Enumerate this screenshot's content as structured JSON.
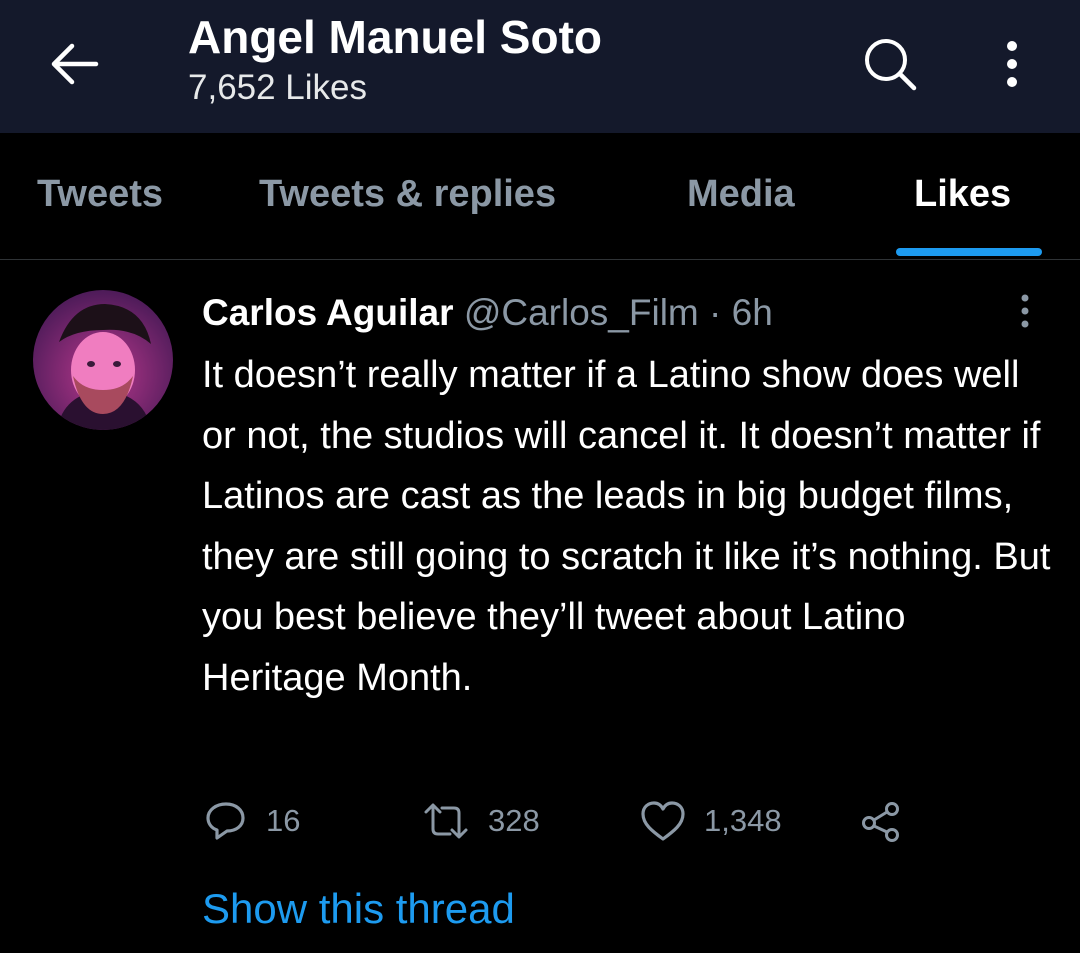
{
  "header": {
    "title": "Angel Manuel Soto",
    "subtitle": "7,652 Likes",
    "icons": [
      "back-arrow-icon",
      "search-icon",
      "more-vertical-icon"
    ]
  },
  "tabs": [
    {
      "label": "Tweets",
      "active": false
    },
    {
      "label": "Tweets & replies",
      "active": false
    },
    {
      "label": "Media",
      "active": false
    },
    {
      "label": "Likes",
      "active": true
    }
  ],
  "tweet": {
    "author_name": "Carlos Aguilar",
    "author_handle": "@Carlos_Film",
    "separator": "·",
    "time": "6h",
    "text": "It doesn’t really matter if a Latino show does well or not, the studios will cancel it. It doesn’t matter if Latinos are cast as the leads in big budget films, they are still going to scratch it like it’s nothing. But you best believe they’ll tweet about Latino Heritage Month.",
    "replies": "16",
    "retweets": "328",
    "likes": "1,348",
    "show_thread": "Show this thread"
  },
  "colors": {
    "header_bg": "#14192b",
    "background": "#000000",
    "accent": "#1d9bf0",
    "muted": "#8b98a5",
    "text": "#ffffff"
  }
}
